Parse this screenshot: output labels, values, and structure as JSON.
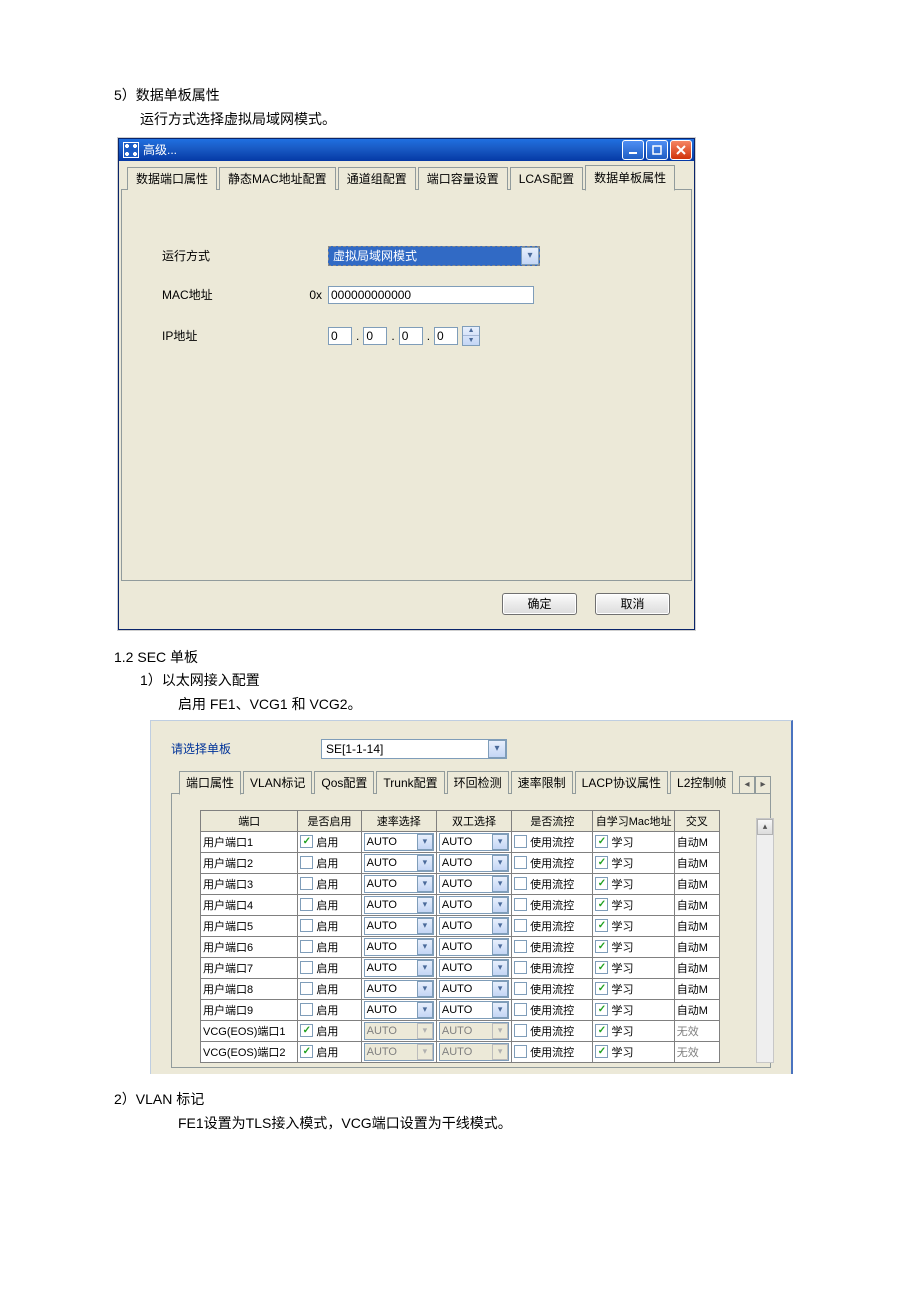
{
  "heading_5": "5）数据单板属性",
  "heading_5_sub": "运行方式选择虚拟局域网模式。",
  "window1": {
    "title": "高级...",
    "tabs": [
      "数据端口属性",
      "静态MAC地址配置",
      "通道组配置",
      "端口容量设置",
      "LCAS配置",
      "数据单板属性"
    ],
    "active_tab_index": 5,
    "labels": {
      "run_mode": "运行方式",
      "mac": "MAC地址",
      "mac_prefix": "0x",
      "ip": "IP地址"
    },
    "values": {
      "run_mode": "虚拟局域网模式",
      "mac": "000000000000",
      "ip": [
        "0",
        "0",
        "0",
        "0"
      ]
    },
    "buttons": {
      "ok": "确定",
      "cancel": "取消"
    }
  },
  "heading_1_2": "1.2 SEC 单板",
  "heading_1_2_1": "1）以太网接入配置",
  "heading_1_2_1_sub": "启用 FE1、VCG1 和 VCG2。",
  "window2": {
    "select_label": "请选择单板",
    "select_value": "SE[1-1-14]",
    "tabs": [
      "端口属性",
      "VLAN标记",
      "Qos配置",
      "Trunk配置",
      "环回检测",
      "速率限制",
      "LACP协议属性",
      "L2控制帧"
    ],
    "active_tab_index": 0,
    "columns": [
      "端口",
      "是否启用",
      "速率选择",
      "双工选择",
      "是否流控",
      "自学习Mac地址",
      "交叉"
    ],
    "enable_label": "启用",
    "flow_label": "使用流控",
    "learn_label": "学习",
    "auto_label": "自动M",
    "invalid_label": "无效",
    "rows": [
      {
        "port": "用户端口1",
        "enable": true,
        "rate": "AUTO",
        "duplex": "AUTO",
        "flow": false,
        "learn": true,
        "cross": "auto",
        "disabled": false
      },
      {
        "port": "用户端口2",
        "enable": false,
        "rate": "AUTO",
        "duplex": "AUTO",
        "flow": false,
        "learn": true,
        "cross": "auto",
        "disabled": false
      },
      {
        "port": "用户端口3",
        "enable": false,
        "rate": "AUTO",
        "duplex": "AUTO",
        "flow": false,
        "learn": true,
        "cross": "auto",
        "disabled": false
      },
      {
        "port": "用户端口4",
        "enable": false,
        "rate": "AUTO",
        "duplex": "AUTO",
        "flow": false,
        "learn": true,
        "cross": "auto",
        "disabled": false
      },
      {
        "port": "用户端口5",
        "enable": false,
        "rate": "AUTO",
        "duplex": "AUTO",
        "flow": false,
        "learn": true,
        "cross": "auto",
        "disabled": false
      },
      {
        "port": "用户端口6",
        "enable": false,
        "rate": "AUTO",
        "duplex": "AUTO",
        "flow": false,
        "learn": true,
        "cross": "auto",
        "disabled": false
      },
      {
        "port": "用户端口7",
        "enable": false,
        "rate": "AUTO",
        "duplex": "AUTO",
        "flow": false,
        "learn": true,
        "cross": "auto",
        "disabled": false
      },
      {
        "port": "用户端口8",
        "enable": false,
        "rate": "AUTO",
        "duplex": "AUTO",
        "flow": false,
        "learn": true,
        "cross": "auto",
        "disabled": false
      },
      {
        "port": "用户端口9",
        "enable": false,
        "rate": "AUTO",
        "duplex": "AUTO",
        "flow": false,
        "learn": true,
        "cross": "auto",
        "disabled": false
      },
      {
        "port": "VCG(EOS)端口1",
        "enable": true,
        "rate": "AUTO",
        "duplex": "AUTO",
        "flow": false,
        "learn": true,
        "cross": "invalid",
        "disabled": true
      },
      {
        "port": "VCG(EOS)端口2",
        "enable": true,
        "rate": "AUTO",
        "duplex": "AUTO",
        "flow": false,
        "learn": true,
        "cross": "invalid",
        "disabled": true
      }
    ]
  },
  "heading_2": "2）VLAN 标记",
  "heading_2_sub": "FE1设置为TLS接入模式，VCG端口设置为干线模式。"
}
